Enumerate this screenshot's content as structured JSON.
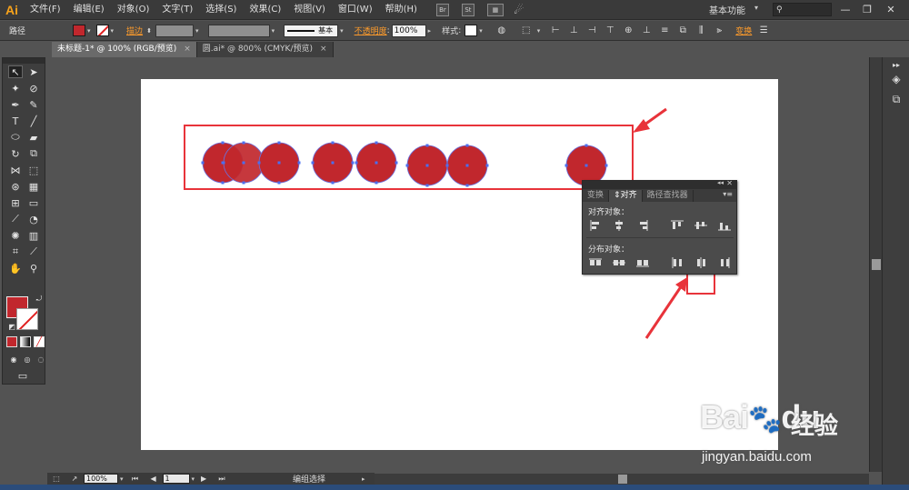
{
  "app": {
    "logo": "Ai"
  },
  "menubar": {
    "items": [
      "文件(F)",
      "编辑(E)",
      "对象(O)",
      "文字(T)",
      "选择(S)",
      "效果(C)",
      "视图(V)",
      "窗口(W)",
      "帮助(H)"
    ],
    "br_icon": "Br",
    "st_icon": "St",
    "workspace": "基本功能",
    "chevron": "▾",
    "search_icon": "⚲",
    "min": "—",
    "max": "❐",
    "close": "✕"
  },
  "controlbar": {
    "selection_label": "路径",
    "stroke_label": "描边",
    "stroke_value": "",
    "brush_label": "基本",
    "opacity_label": "不透明度",
    "opacity_value": "100%",
    "style_label": "样式",
    "transform_label": "变换",
    "fill_color": "#c1272d"
  },
  "tabs": [
    {
      "label": "未标题-1* @ 100% (RGB/预览)",
      "close": "×"
    },
    {
      "label": "圆.ai* @ 800% (CMYK/预览)",
      "close": "×"
    }
  ],
  "toolbox": {
    "fill_color": "#c1272d",
    "stroke_color": "#ffffff"
  },
  "align_panel": {
    "tabs": [
      "变换",
      "对齐",
      "路径查找器"
    ],
    "align_objects_label": "对齐对象：",
    "distribute_objects_label": "分布对象：",
    "menu_icon": "▾≡",
    "collapse": "◂◂",
    "close": "✕"
  },
  "statusbar": {
    "zoom": "100%",
    "page": "1",
    "mode": "编组选择"
  },
  "watermark": {
    "brand": "Bai",
    "brand2": "du",
    "cn": "经验",
    "url": "jingyan.baidu.com"
  },
  "colors": {
    "circle_fill": "#c1272d",
    "selection_blue": "#4a6ff0",
    "annotation_red": "#e8333a"
  }
}
